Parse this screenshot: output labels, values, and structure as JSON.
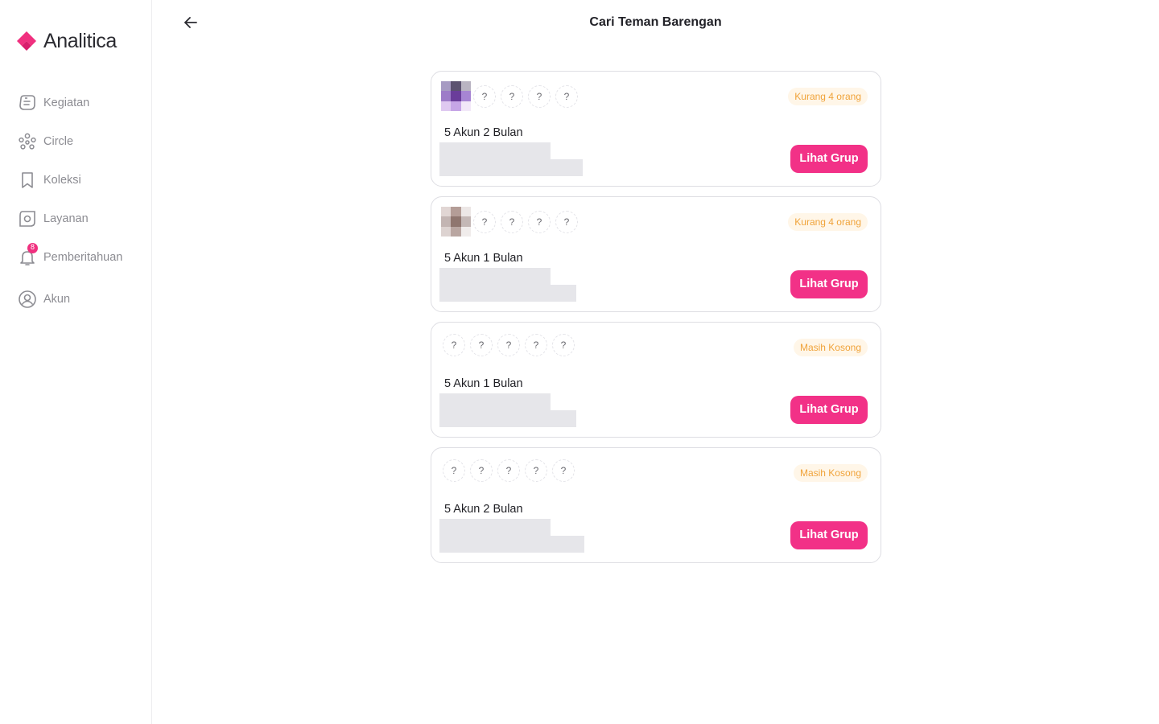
{
  "brand": {
    "name": "Analitica",
    "accent": "#f0307f"
  },
  "sidebar": {
    "items": [
      {
        "label": "Kegiatan",
        "icon": "activity-icon"
      },
      {
        "label": "Circle",
        "icon": "circle-group-icon"
      },
      {
        "label": "Koleksi",
        "icon": "bookmark-icon"
      },
      {
        "label": "Layanan",
        "icon": "service-icon"
      },
      {
        "label": "Pemberitahuan",
        "icon": "bell-icon",
        "badge": "8"
      },
      {
        "label": "Akun",
        "icon": "user-icon"
      }
    ]
  },
  "header": {
    "title": "Cari Teman Barengan",
    "back_icon": "arrow-left-icon"
  },
  "groups": [
    {
      "title": "5 Akun 2 Bulan",
      "status": "Kurang 4 orang",
      "button": "Lihat Grup",
      "filled": 1,
      "slot_text": "?",
      "avatar_palette": [
        "#a79bc3",
        "#5c5270",
        "#b9b4c2",
        "#9d7cc8",
        "#6a3d9a",
        "#a785d3",
        "#dfc9f1",
        "#c6a5e6",
        "#f2e8f8"
      ]
    },
    {
      "title": "5 Akun 1 Bulan",
      "status": "Kurang 4 orang",
      "button": "Lihat Grup",
      "filled": 1,
      "slot_text": "?",
      "avatar_palette": [
        "#e1d6d4",
        "#b49d97",
        "#ece7e6",
        "#c3b5b3",
        "#8f766f",
        "#c4b8b6",
        "#ddd3d1",
        "#b9a6a1",
        "#f0eceb"
      ]
    },
    {
      "title": "5 Akun 1 Bulan",
      "status": "Masih Kosong",
      "button": "Lihat Grup",
      "filled": 0,
      "slot_text": "?"
    },
    {
      "title": "5 Akun 2 Bulan",
      "status": "Masih Kosong",
      "button": "Lihat Grup",
      "filled": 0,
      "slot_text": "?"
    }
  ]
}
